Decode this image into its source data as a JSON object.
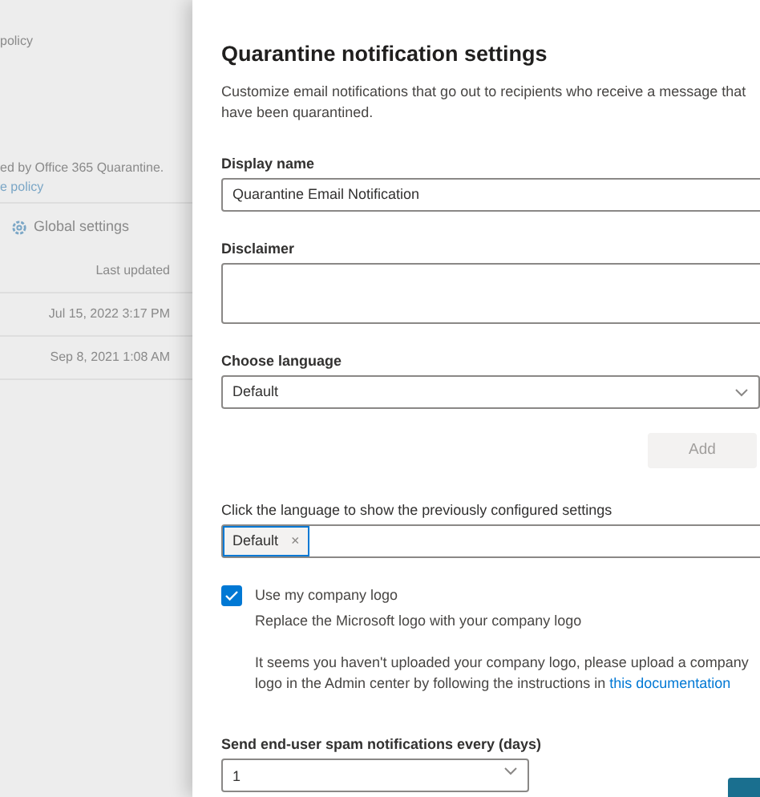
{
  "background_page": {
    "heading_fragment": "policy",
    "description_fragment": "ed by Office 365 Quarantine.",
    "link_fragment": "e policy",
    "toolbar_button": "Global settings",
    "table": {
      "columns": [
        "Last updated"
      ],
      "rows": [
        [
          "Jul 15, 2022 3:17 PM"
        ],
        [
          "Sep 8, 2021 1:08 AM"
        ]
      ]
    }
  },
  "panel": {
    "title": "Quarantine notification settings",
    "description": "Customize email notifications that go out to recipients who receive a message that have been quarantined.",
    "display_name": {
      "label": "Display name",
      "value": "Quarantine Email Notification"
    },
    "disclaimer": {
      "label": "Disclaimer"
    },
    "language": {
      "label": "Choose language",
      "value": "Default"
    },
    "add_button": {
      "label": "Add",
      "disabled": true
    },
    "configured": {
      "label": "Click the language to show the previously configured settings",
      "tags": [
        {
          "label": "Default",
          "remove": "×"
        }
      ]
    },
    "company_logo": {
      "label": "Use my company logo",
      "checked": true,
      "hint": "Replace the Microsoft logo with your company logo",
      "note": "It seems you haven't uploaded your company logo, please upload a company logo in the Admin center by following the instructions in",
      "note_link": "this documentation"
    },
    "frequency": {
      "label": "Send end-user spam notifications every (days)",
      "value": "1"
    }
  }
}
